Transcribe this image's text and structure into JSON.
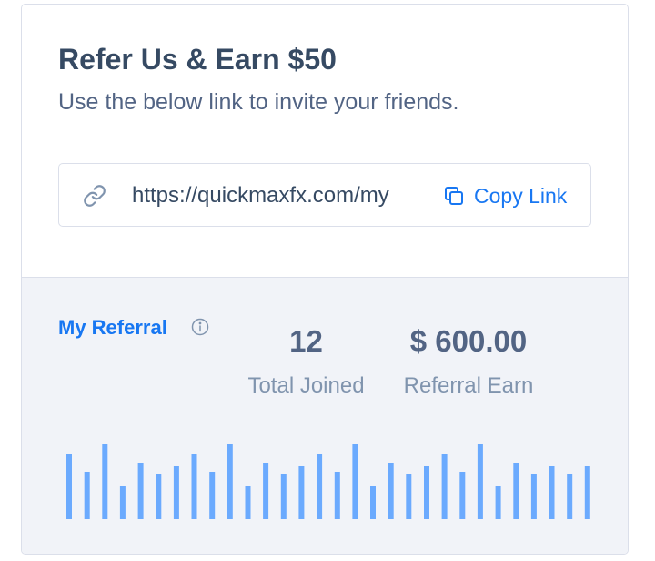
{
  "card": {
    "title": "Refer Us & Earn $50",
    "subtitle": "Use the below link to invite your friends.",
    "referral_url": "https://quickmaxfx.com/my",
    "copy_label": "Copy Link"
  },
  "referral": {
    "label": "My Referral",
    "stats": [
      {
        "value": "12",
        "label": "Total Joined"
      },
      {
        "value": "$ 600.00",
        "label": "Referral Earn"
      }
    ]
  },
  "colors": {
    "accent": "#1877f2",
    "bar": "#6baafe",
    "panel_bg": "#f1f3f8"
  },
  "chart_data": {
    "type": "bar",
    "values": [
      72,
      52,
      82,
      36,
      62,
      49,
      58,
      72,
      52,
      82,
      36,
      62,
      49,
      58,
      72,
      52,
      82,
      36,
      62,
      49,
      58,
      72,
      52,
      82,
      36,
      62,
      49,
      58,
      49,
      58
    ],
    "ylim": [
      0,
      82
    ]
  }
}
